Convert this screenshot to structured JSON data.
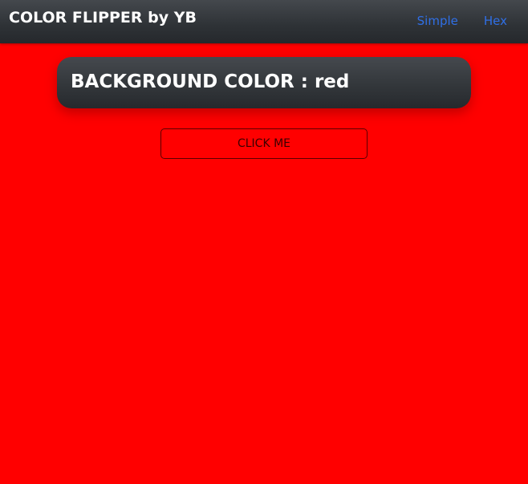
{
  "navbar": {
    "brand": "COLOR FLIPPER by YB",
    "links": [
      {
        "label": "Simple"
      },
      {
        "label": "Hex"
      }
    ],
    "link_color": "#2f6fe6"
  },
  "main": {
    "background_label": "BACKGROUND COLOR : ",
    "background_value": "red",
    "background_color": "#ff0000",
    "button_label": "CLICK ME"
  }
}
